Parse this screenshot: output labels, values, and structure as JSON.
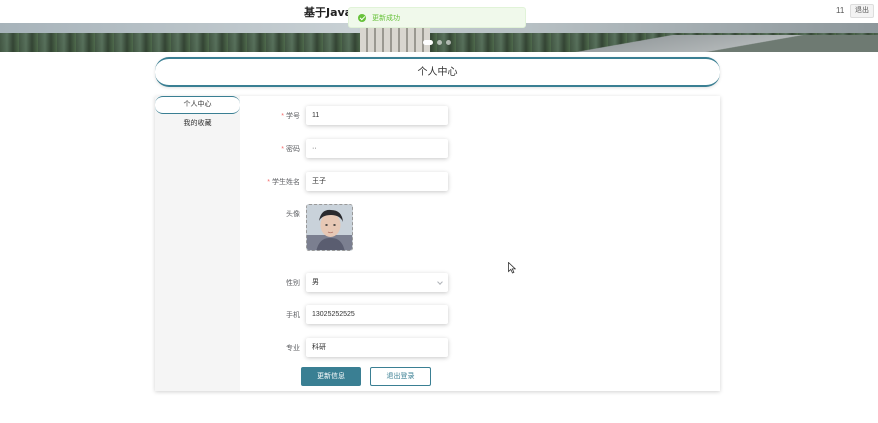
{
  "header": {
    "site_title_start": "基于Java",
    "site_title_end": "",
    "username": "11",
    "logout_label": "退出"
  },
  "toast": {
    "message": "更新成功"
  },
  "page": {
    "title": "个人中心"
  },
  "sidebar": {
    "items": [
      {
        "label": "个人中心",
        "active": true
      },
      {
        "label": "我的收藏",
        "active": false
      }
    ]
  },
  "form": {
    "student_id": {
      "label": "学号",
      "value": "11",
      "required": true
    },
    "password": {
      "label": "密码",
      "value": "··",
      "required": true
    },
    "student_name": {
      "label": "学生姓名",
      "value": "王子",
      "required": true
    },
    "avatar": {
      "label": "头像"
    },
    "gender": {
      "label": "性别",
      "value": "男"
    },
    "phone": {
      "label": "手机",
      "value": "13025252525"
    },
    "major": {
      "label": "专业",
      "value": "科研"
    }
  },
  "buttons": {
    "update": "更新信息",
    "logout": "退出登录"
  },
  "colors": {
    "accent": "#3a7f93",
    "success": "#67c23a",
    "required": "#f56c6c"
  }
}
